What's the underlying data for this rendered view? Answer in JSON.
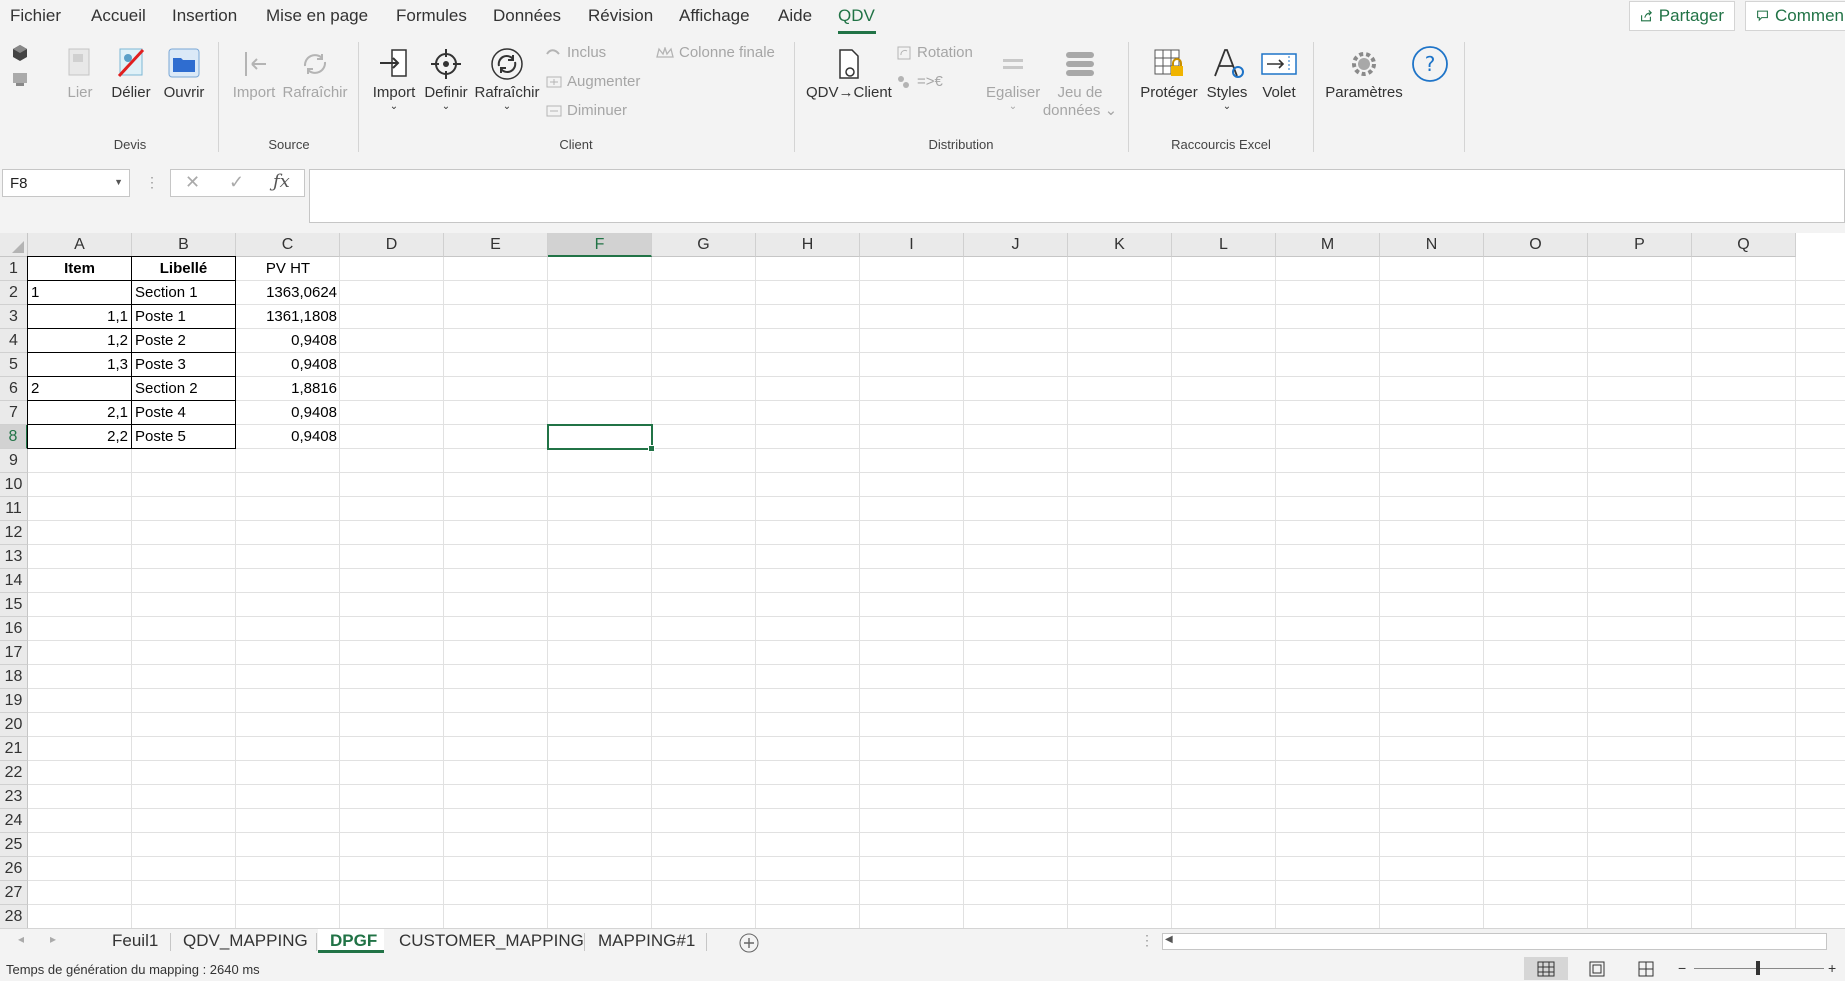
{
  "menu": {
    "tabs": [
      "Fichier",
      "Accueil",
      "Insertion",
      "Mise en page",
      "Formules",
      "Données",
      "Révision",
      "Affichage",
      "Aide",
      "QDV"
    ],
    "active_tab": "QDV",
    "share_label": "Partager",
    "comment_label": "Commen"
  },
  "ribbon": {
    "groups": {
      "devis": "Devis",
      "source": "Source",
      "client": "Client",
      "distribution": "Distribution",
      "raccourcis": "Raccourcis Excel"
    },
    "devis": {
      "lier": "Lier",
      "delier": "Délier",
      "ouvrir": "Ouvrir"
    },
    "source": {
      "import": "Import",
      "rafraichir": "Rafraîchir"
    },
    "client": {
      "import": "Import",
      "definir": "Definir",
      "rafraichir": "Rafraîchir",
      "inclus": "Inclus",
      "augmenter": "Augmenter",
      "diminuer": "Diminuer",
      "colonne_finale": "Colonne finale"
    },
    "distribution": {
      "qdv_client": "QDV→Client",
      "rotation": "Rotation",
      "eq_euro": "=>€",
      "egaliser": "Egaliser",
      "jeu_line1": "Jeu de",
      "jeu_line2": "données"
    },
    "raccourcis": {
      "proteger": "Protéger",
      "styles": "Styles",
      "volet": "Volet"
    },
    "parametres": "Paramètres"
  },
  "formula_bar": {
    "name_box": "F8",
    "formula": ""
  },
  "sheet": {
    "columns": [
      "A",
      "B",
      "C",
      "D",
      "E",
      "F",
      "G",
      "H",
      "I",
      "J",
      "K",
      "L",
      "M",
      "N",
      "O",
      "P",
      "Q"
    ],
    "selected_column": "F",
    "selected_row": 8,
    "row_count": 28,
    "cells": {
      "A1": "Item",
      "B1": "Libellé",
      "C1": "PV HT",
      "A2": "1",
      "B2": "Section 1",
      "C2": "1363,0624",
      "A3": "1,1",
      "B3": "Poste 1",
      "C3": "1361,1808",
      "A4": "1,2",
      "B4": "Poste 2",
      "C4": "0,9408",
      "A5": "1,3",
      "B5": "Poste 3",
      "C5": "0,9408",
      "A6": "2",
      "B6": "Section 2",
      "C6": "1,8816",
      "A7": "2,1",
      "B7": "Poste 4",
      "C7": "0,9408",
      "A8": "2,2",
      "B8": "Poste 5",
      "C8": "0,9408"
    }
  },
  "sheet_tabs": [
    "Feuil1",
    "QDV_MAPPING",
    "DPGF",
    "CUSTOMER_MAPPING",
    "MAPPING#1"
  ],
  "active_sheet": "DPGF",
  "status": {
    "text": "Temps de génération du mapping : 2640 ms"
  },
  "colors": {
    "accent": "#217346",
    "disabled": "#a6a6a6",
    "link_blue": "#1e74c8"
  }
}
